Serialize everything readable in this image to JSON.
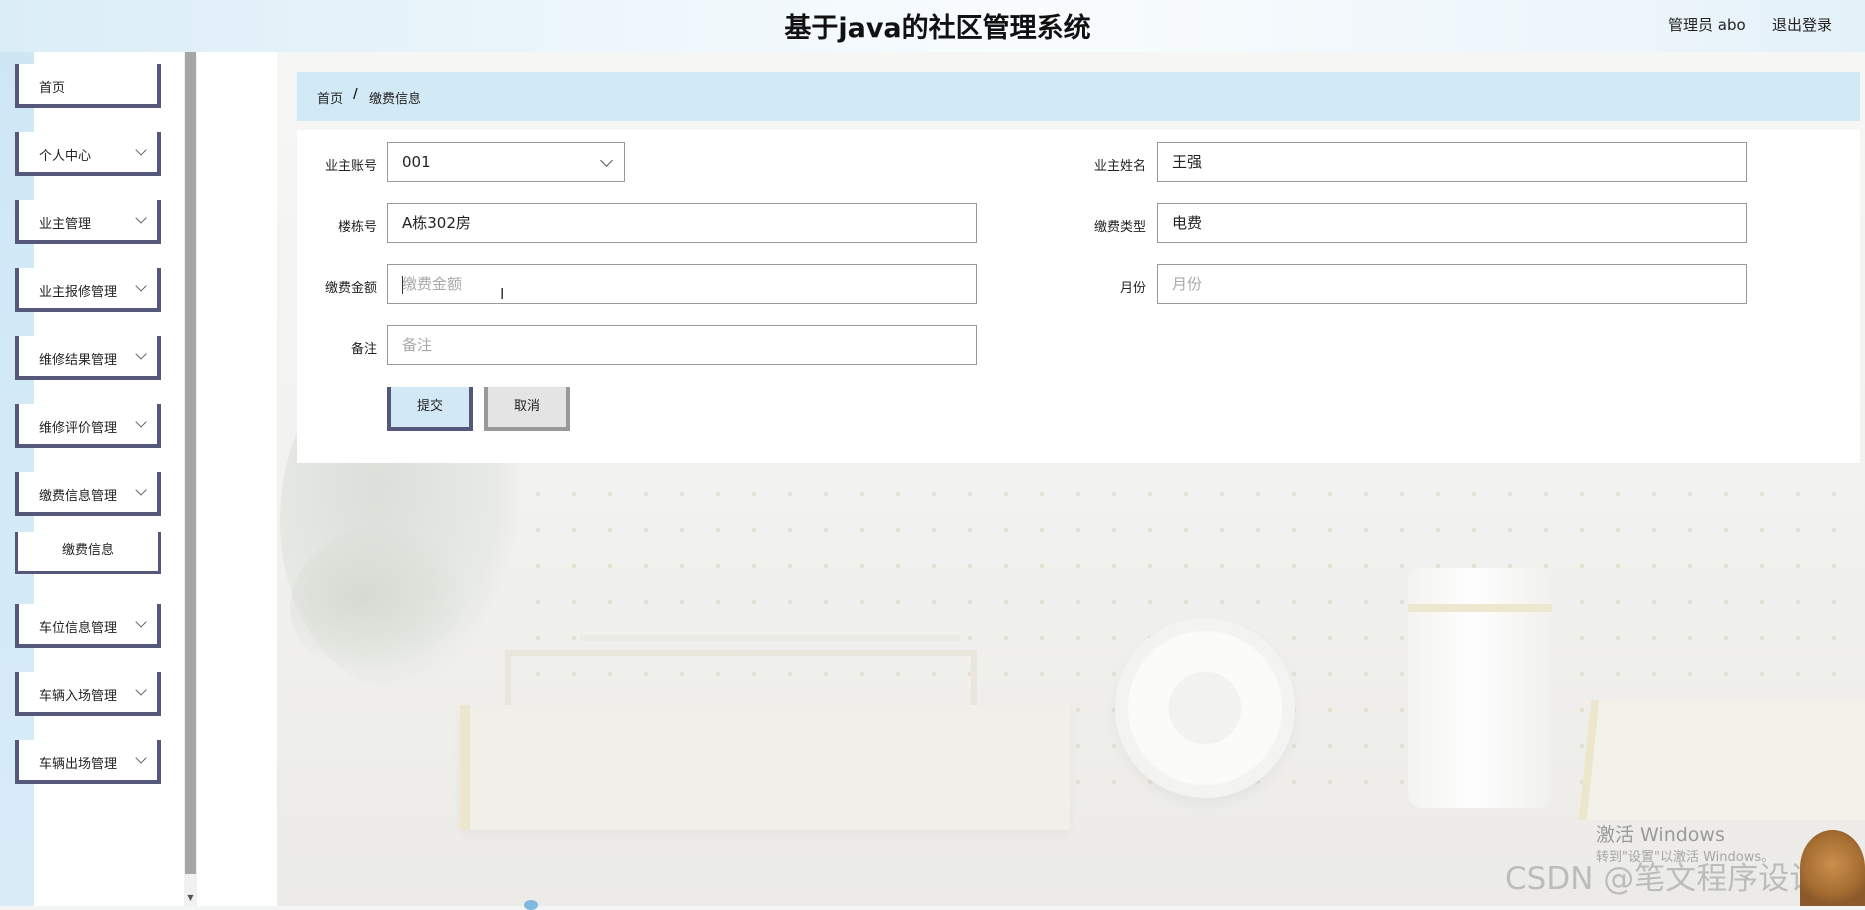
{
  "header": {
    "title": "基于java的社区管理系统",
    "user_label": "管理员 abo",
    "logout_label": "退出登录"
  },
  "sidebar": {
    "items": [
      {
        "label": "首页"
      },
      {
        "label": "个人中心"
      },
      {
        "label": "业主管理"
      },
      {
        "label": "业主报修管理"
      },
      {
        "label": "维修结果管理"
      },
      {
        "label": "维修评价管理"
      },
      {
        "label": "缴费信息管理"
      },
      {
        "label": "缴费信息"
      },
      {
        "label": "车位信息管理"
      },
      {
        "label": "车辆入场管理"
      },
      {
        "label": "车辆出场管理"
      }
    ]
  },
  "breadcrumb": {
    "home": "首页",
    "separator": "/",
    "current": "缴费信息"
  },
  "form": {
    "owner_account": {
      "label": "业主账号",
      "value": "001"
    },
    "owner_name": {
      "label": "业主姓名",
      "value": "王强"
    },
    "building": {
      "label": "楼栋号",
      "value": "A栋302房"
    },
    "fee_type": {
      "label": "缴费类型",
      "value": "电费"
    },
    "amount": {
      "label": "缴费金额",
      "placeholder": "缴费金额"
    },
    "month": {
      "label": "月份",
      "placeholder": "月份"
    },
    "remark": {
      "label": "备注",
      "placeholder": "备注"
    },
    "submit_label": "提交",
    "cancel_label": "取消"
  },
  "overlay": {
    "activation_title": "激活 Windows",
    "activation_sub": "转到\"设置\"以激活 Windows。",
    "watermark": "CSDN @笔文程序设计"
  },
  "colors": {
    "accent_border": "#55587a",
    "breadcrumb_bg": "#d2e9f6",
    "submit_bg": "#d3e8f5"
  }
}
